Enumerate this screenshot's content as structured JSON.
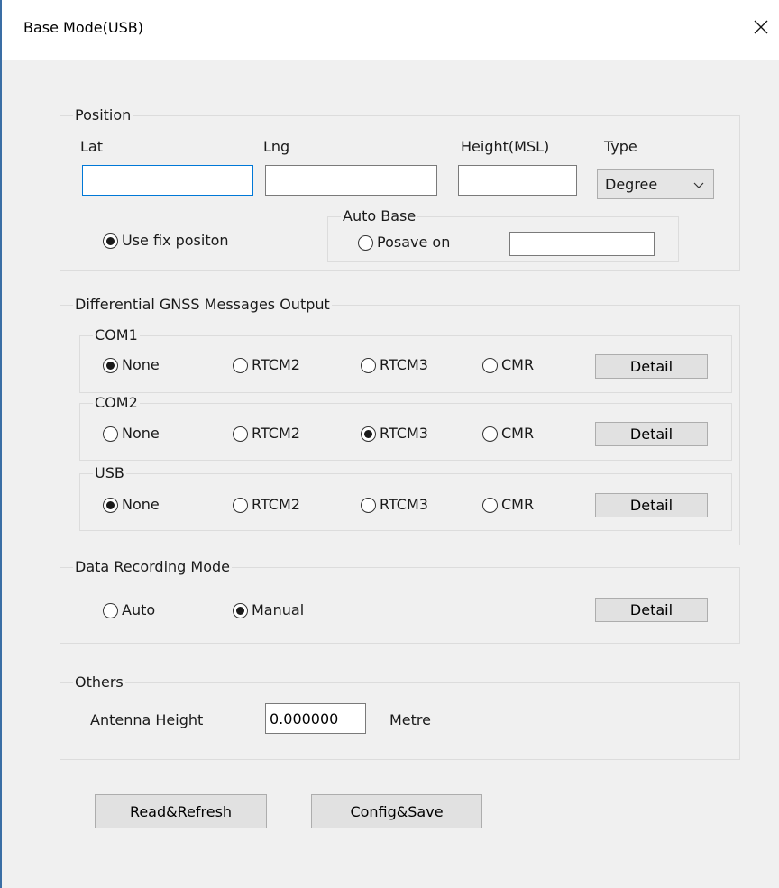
{
  "window": {
    "title": "Base Mode(USB)",
    "close_glyph": "✕"
  },
  "position": {
    "legend": "Position",
    "lat_label": "Lat",
    "lng_label": "Lng",
    "height_label": "Height(MSL)",
    "type_label": "Type",
    "lat_value": "",
    "lng_value": "",
    "height_value": "",
    "type_selected": "Degree",
    "use_fix_label": "Use fix positon",
    "use_fix_checked": true,
    "auto_base_legend": "Auto Base",
    "posave_label": "Posave on",
    "posave_checked": false,
    "posave_value": ""
  },
  "diff": {
    "legend": "Differential GNSS Messages Output",
    "ports": [
      {
        "name": "COM1",
        "none": "None",
        "rtcm2": "RTCM2",
        "rtcm3": "RTCM3",
        "cmr": "CMR",
        "selected": "None",
        "detail": "Detail"
      },
      {
        "name": "COM2",
        "none": "None",
        "rtcm2": "RTCM2",
        "rtcm3": "RTCM3",
        "cmr": "CMR",
        "selected": "RTCM3",
        "detail": "Detail"
      },
      {
        "name": "USB",
        "none": "None",
        "rtcm2": "RTCM2",
        "rtcm3": "RTCM3",
        "cmr": "CMR",
        "selected": "None",
        "detail": "Detail"
      }
    ]
  },
  "recording": {
    "legend": "Data Recording Mode",
    "auto": "Auto",
    "manual": "Manual",
    "selected": "Manual",
    "detail": "Detail"
  },
  "others": {
    "legend": "Others",
    "antenna_label": "Antenna Height",
    "antenna_value": "0.000000",
    "unit": "Metre"
  },
  "footer": {
    "read_refresh": "Read&Refresh",
    "config_save": "Config&Save"
  },
  "icons": {
    "close": "close-icon",
    "dropdown": "chevron-down-icon"
  },
  "colors": {
    "focus_border": "#0078d7",
    "window_bg": "#f0f0f0",
    "button_bg": "#e1e1e1"
  }
}
